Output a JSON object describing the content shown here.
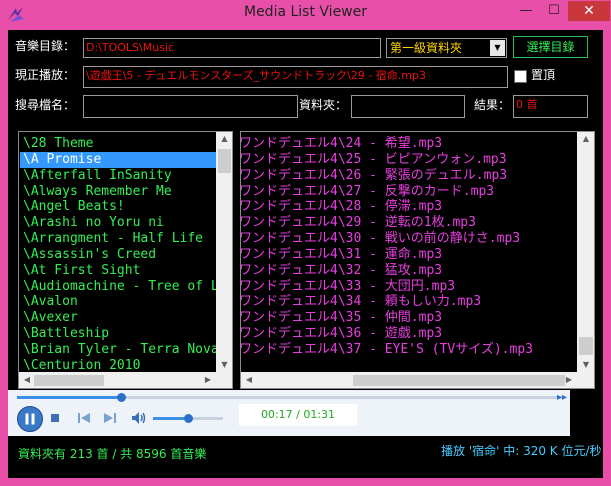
{
  "window": {
    "title": "Media List Viewer",
    "min_glyph": "—",
    "max_glyph": "☐",
    "close_glyph": "✕"
  },
  "form": {
    "music_dir_label": "音樂目錄：",
    "music_dir_value": "D:\\TOOLS\\Music",
    "level_combo_value": "第一級資料夾",
    "choose_dir_button": "選擇目錄",
    "now_playing_label": "現正播放：",
    "now_playing_value": "\\遊戯王\\5 - デュエルモンスターズ_サウンドトラック\\29 - 宿命.mp3",
    "pin_label": "置頂",
    "pin_checked": false,
    "search_label": "搜尋檔名：",
    "search_value": "",
    "folder_label": "資料夾：",
    "folder_value": "",
    "result_label": "結果：",
    "result_value": "0 首"
  },
  "folders": [
    "\\28 Theme",
    "\\A Promise",
    "\\Afterfall InSanity",
    "\\Always Remember Me",
    "\\Angel Beats!",
    "\\Arashi no Yoru ni",
    "\\Arrangment - Half Life",
    "\\Assassin's Creed",
    "\\At First Sight",
    "\\Audiomachine - Tree of Life",
    "\\Avalon",
    "\\Avexer",
    "\\Battleship",
    "\\Brian Tyler - Terra Nova",
    "\\Centurion 2010"
  ],
  "selected_folder_index": 1,
  "songs": [
    "ワンドデュエル4\\24 - 希望.mp3",
    "ワンドデュエル4\\25 - ビピアンウォン.mp3",
    "ワンドデュエル4\\26 - 緊張のデュエル.mp3",
    "ワンドデュエル4\\27 - 反撃のカード.mp3",
    "ワンドデュエル4\\28 - 停滞.mp3",
    "ワンドデュエル4\\29 - 逆転の1枚.mp3",
    "ワンドデュエル4\\30 - 戦いの前の静けさ.mp3",
    "ワンドデュエル4\\31 - 運命.mp3",
    "ワンドデュエル4\\32 - 猛攻.mp3",
    "ワンドデュエル4\\33 - 大団円.mp3",
    "ワンドデュエル4\\34 - 頼もしい力.mp3",
    "ワンドデュエル4\\35 - 仲間.mp3",
    "ワンドデュエル4\\36 - 遊戯.mp3",
    "ワンドデュエル4\\37 - EYE'S (TVサイズ).mp3"
  ],
  "player": {
    "time": "00:17 / 01:31",
    "progress": 0.19,
    "volume": 0.5
  },
  "status": {
    "left": "資料夾有 213 首 / 共 8596 首音樂",
    "right": "播放 '宿命' 中: 320 K 位元/秒"
  },
  "colors": {
    "window_frame": "#e84fa9",
    "background": "#000000",
    "folder_text": "#33ee55",
    "song_text": "#e83ee0",
    "selection": "#3399ff",
    "path_text": "#ee1111"
  }
}
